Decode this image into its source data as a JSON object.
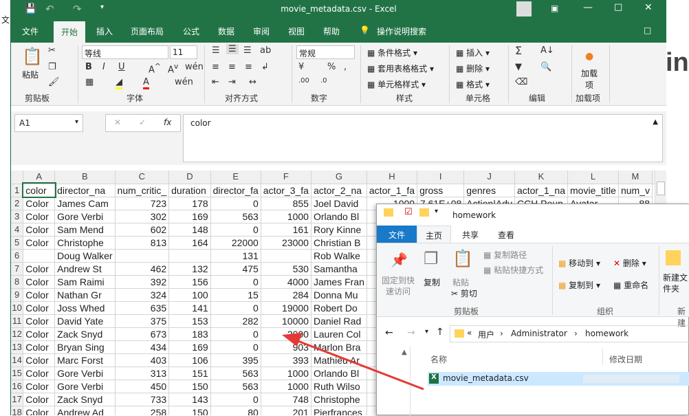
{
  "background": {
    "left_char": "文",
    "right_text": "ing"
  },
  "excel": {
    "title": "movie_metadata.csv  -  Excel",
    "tabs": [
      "文件",
      "开始",
      "插入",
      "页面布局",
      "公式",
      "数据",
      "审阅",
      "视图",
      "帮助"
    ],
    "tell_me": "操作说明搜索",
    "ribbon": {
      "paste": "粘贴",
      "clipboard": "剪贴板",
      "font_name": "等线",
      "font_size": "11",
      "font_group": "字体",
      "align_group": "对齐方式",
      "number_format": "常规",
      "number_group": "数字",
      "cond_format": "条件格式",
      "table_format": "套用表格格式",
      "cell_style": "单元格样式",
      "styles_group": "样式",
      "insert": "插入",
      "delete": "删除",
      "format": "格式",
      "cells_group": "单元格",
      "edit_group": "编辑",
      "addin": "加载项",
      "addin_group": "加载项"
    },
    "name_box": "A1",
    "formula": "color",
    "columns": [
      "A",
      "B",
      "C",
      "D",
      "E",
      "F",
      "G",
      "H",
      "I",
      "J",
      "K",
      "L",
      "M"
    ],
    "rows": [
      [
        "1",
        "color",
        "director_na",
        "num_critic_",
        "duration",
        "director_fa",
        "actor_3_fa",
        "actor_2_na",
        "actor_1_fa",
        "gross",
        "genres",
        "actor_1_na",
        "movie_title",
        "num_v"
      ],
      [
        "2",
        "Color",
        "James Cam",
        "723",
        "178",
        "0",
        "855",
        "Joel David",
        "1000",
        "7.61E+08",
        "Action|Adv",
        "CCH Poun",
        "Avatar",
        "88"
      ],
      [
        "3",
        "Color",
        "Gore Verbi",
        "302",
        "169",
        "563",
        "1000",
        "Orlando Bl",
        "",
        "",
        "",
        "",
        "",
        ""
      ],
      [
        "4",
        "Color",
        "Sam Mend",
        "602",
        "148",
        "0",
        "161",
        "Rory Kinne",
        "",
        "",
        "",
        "",
        "",
        ""
      ],
      [
        "5",
        "Color",
        "Christophe",
        "813",
        "164",
        "22000",
        "23000",
        "Christian B",
        "",
        "",
        "",
        "",
        "",
        ""
      ],
      [
        "6",
        "",
        "Doug Walker",
        "",
        "",
        "131",
        "",
        "Rob Walke",
        "",
        "",
        "",
        "",
        "",
        ""
      ],
      [
        "7",
        "Color",
        "Andrew St",
        "462",
        "132",
        "475",
        "530",
        "Samantha",
        "",
        "",
        "",
        "",
        "",
        ""
      ],
      [
        "8",
        "Color",
        "Sam Raimi",
        "392",
        "156",
        "0",
        "4000",
        "James Fran",
        "",
        "",
        "",
        "",
        "",
        ""
      ],
      [
        "9",
        "Color",
        "Nathan Gr",
        "324",
        "100",
        "15",
        "284",
        "Donna Mu",
        "",
        "",
        "",
        "",
        "",
        ""
      ],
      [
        "10",
        "Color",
        "Joss Whed",
        "635",
        "141",
        "0",
        "19000",
        "Robert Do",
        "",
        "",
        "",
        "",
        "",
        ""
      ],
      [
        "11",
        "Color",
        "David Yate",
        "375",
        "153",
        "282",
        "10000",
        "Daniel Rad",
        "",
        "",
        "",
        "",
        "",
        ""
      ],
      [
        "12",
        "Color",
        "Zack Snyd",
        "673",
        "183",
        "0",
        "2000",
        "Lauren Col",
        "",
        "",
        "",
        "",
        "",
        ""
      ],
      [
        "13",
        "Color",
        "Bryan Sing",
        "434",
        "169",
        "0",
        "903",
        "Marlon Bra",
        "",
        "",
        "",
        "",
        "",
        ""
      ],
      [
        "14",
        "Color",
        "Marc Forst",
        "403",
        "106",
        "395",
        "393",
        "Mathieu Ar",
        "",
        "",
        "",
        "",
        "",
        ""
      ],
      [
        "15",
        "Color",
        "Gore Verbi",
        "313",
        "151",
        "563",
        "1000",
        "Orlando Bl",
        "",
        "",
        "",
        "",
        "",
        ""
      ],
      [
        "16",
        "Color",
        "Gore Verbi",
        "450",
        "150",
        "563",
        "1000",
        "Ruth Wilso",
        "",
        "",
        "",
        "",
        "",
        ""
      ],
      [
        "17",
        "Color",
        "Zack Snyd",
        "733",
        "143",
        "0",
        "748",
        "Christophe",
        "",
        "",
        "",
        "",
        "",
        ""
      ],
      [
        "18",
        "Color",
        "Andrew Ad",
        "258",
        "150",
        "80",
        "201",
        "Pierfrances",
        "",
        "",
        "",
        "",
        "",
        ""
      ]
    ]
  },
  "explorer": {
    "title": "homework",
    "tabs": [
      "文件",
      "主页",
      "共享",
      "查看"
    ],
    "ribbon": {
      "pin": "固定到快速访问",
      "copy": "复制",
      "paste": "粘贴",
      "copy_path": "复制路径",
      "paste_shortcut": "粘贴快捷方式",
      "cut": "剪切",
      "clipboard": "剪贴板",
      "move_to": "移动到",
      "copy_to": "复制到",
      "delete": "删除",
      "rename": "重命名",
      "organize": "组织",
      "new_folder": "新建文件夹",
      "new_group": "新建"
    },
    "path": [
      "用户",
      "Administrator",
      "homework"
    ],
    "col_name": "名称",
    "col_date": "修改日期",
    "file": "movie_metadata.csv"
  }
}
